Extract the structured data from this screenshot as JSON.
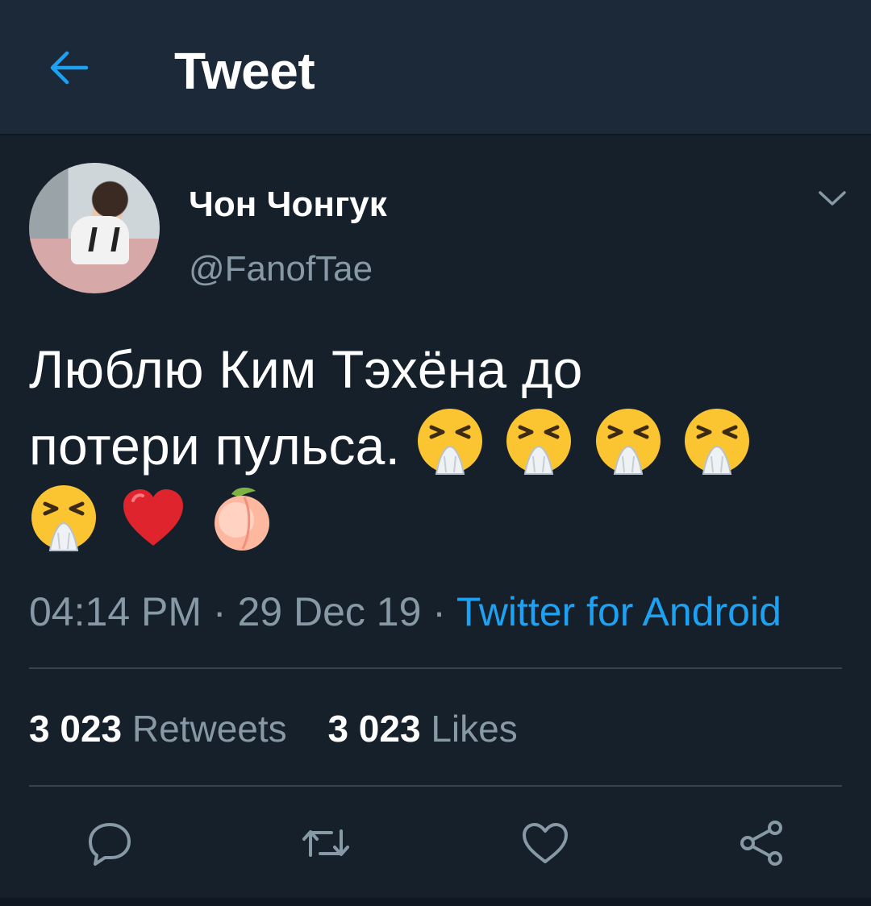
{
  "header": {
    "title": "Tweet",
    "back_icon": "back-arrow-icon"
  },
  "tweet": {
    "author_name": "Чон Чонгук",
    "author_handle": "@FanofTae",
    "text_line1": "Люблю Ким Тэхёна до",
    "text_line2": "потери пульса.",
    "emojis": [
      "sneezing-face",
      "sneezing-face",
      "sneezing-face",
      "sneezing-face",
      "sneezing-face",
      "red-heart",
      "peach"
    ],
    "time": "04:14 PM",
    "sep1": " · ",
    "date": "29 Dec 19",
    "sep2": " · ",
    "source": "Twitter for Android"
  },
  "stats": {
    "retweets_count": "3 023",
    "retweets_label": "Retweets",
    "likes_count": "3 023",
    "likes_label": "Likes"
  },
  "colors": {
    "background": "#15202b",
    "header": "#1c2938",
    "accent": "#1da1f2",
    "secondary_text": "#8899a6",
    "divider": "#38444d"
  }
}
